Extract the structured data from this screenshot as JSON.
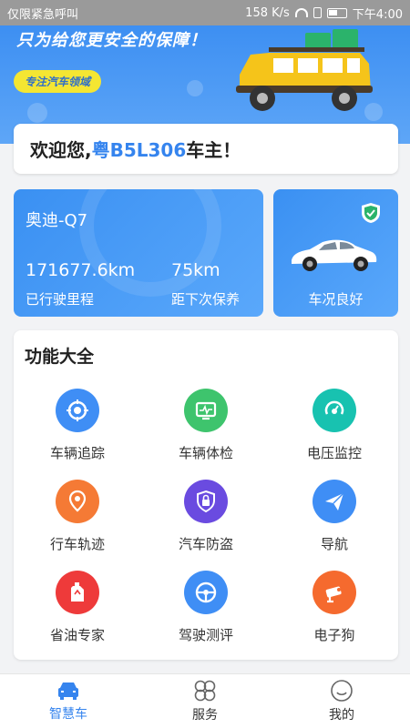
{
  "status_bar": {
    "carrier": "仅限紧急呼叫",
    "speed": "158 K/s",
    "time": "下午4:00"
  },
  "banner": {
    "title": "只为给您更安全的保障！",
    "tag": "专注汽车领域"
  },
  "welcome": {
    "prefix": "欢迎您,",
    "plate": "粤B5L306",
    "suffix": "车主！"
  },
  "car": {
    "name": "奥迪-Q7",
    "mileage_value": "171677.6km",
    "mileage_label": "已行驶里程",
    "maintenance_value": "75km",
    "maintenance_label": "距下次保养",
    "condition_label": "车况良好"
  },
  "features": {
    "title": "功能大全",
    "items": [
      {
        "label": "车辆追踪",
        "icon": "target-icon",
        "color": "#3f8ef5"
      },
      {
        "label": "车辆体检",
        "icon": "monitor-icon",
        "color": "#3ec46d"
      },
      {
        "label": "电压监控",
        "icon": "voltage-icon",
        "color": "#18c2b0"
      },
      {
        "label": "行车轨迹",
        "icon": "location-pin-icon",
        "color": "#f57a35"
      },
      {
        "label": "汽车防盗",
        "icon": "lock-shield-icon",
        "color": "#6a4be0"
      },
      {
        "label": "导航",
        "icon": "paper-plane-icon",
        "color": "#3f8ef5"
      },
      {
        "label": "省油专家",
        "icon": "fuel-can-icon",
        "color": "#ee3a3a"
      },
      {
        "label": "驾驶测评",
        "icon": "steering-wheel-icon",
        "color": "#3f8ef5"
      },
      {
        "label": "电子狗",
        "icon": "camera-icon",
        "color": "#f56a2e"
      }
    ]
  },
  "nav": {
    "items": [
      {
        "label": "智慧车",
        "icon": "car-icon",
        "active": true
      },
      {
        "label": "服务",
        "icon": "grid-clover-icon",
        "active": false
      },
      {
        "label": "我的",
        "icon": "profile-face-icon",
        "active": false
      }
    ],
    "active_color": "#3584ee"
  }
}
